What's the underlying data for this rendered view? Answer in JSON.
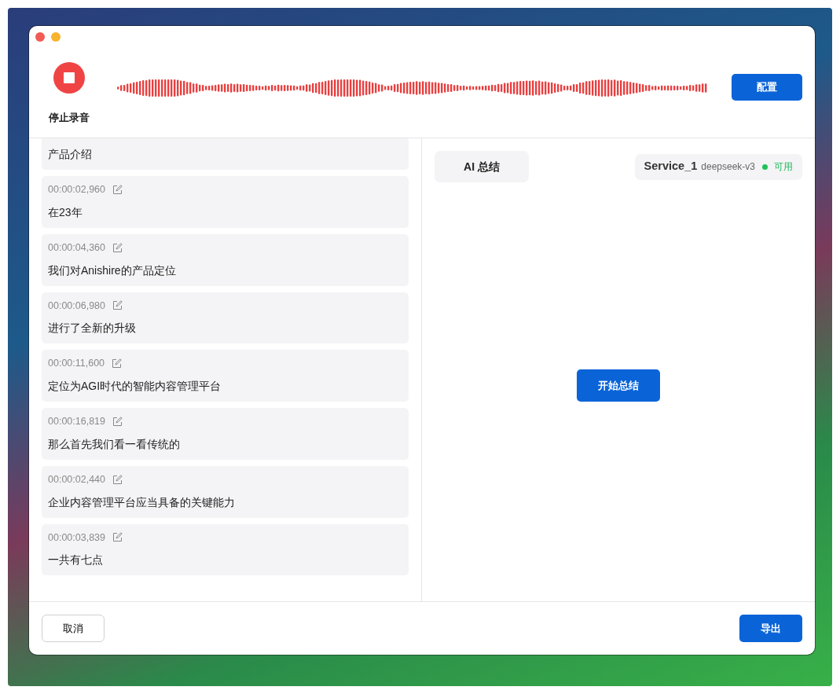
{
  "window": {
    "controls": [
      {
        "color": "#f25c54"
      },
      {
        "color": "#f7b42c"
      }
    ]
  },
  "recorder": {
    "recording": true,
    "stop_label": "停止录音"
  },
  "config_button": "配置",
  "transcript": [
    {
      "text": "产品介绍"
    },
    {
      "time": "00:00:02,960",
      "text": "在23年"
    },
    {
      "time": "00:00:04,360",
      "text": "我们对Anishire的产品定位"
    },
    {
      "time": "00:00:06,980",
      "text": "进行了全新的升级"
    },
    {
      "time": "00:00:11,600",
      "text": "定位为AGI时代的智能内容管理平台"
    },
    {
      "time": "00:00:16,819",
      "text": "那么首先我们看一看传统的"
    },
    {
      "time": "00:00:02,440",
      "text": "企业内容管理平台应当具备的关键能力"
    },
    {
      "time": "00:00:03,839",
      "text": "一共有七点"
    }
  ],
  "summary": {
    "tab": "AI 总结",
    "service": {
      "name": "Service_1",
      "model": "deepseek-v3",
      "available": true,
      "status": "可用"
    },
    "start_button": "开始总结"
  },
  "footer": {
    "cancel": "取消",
    "export": "导出"
  }
}
